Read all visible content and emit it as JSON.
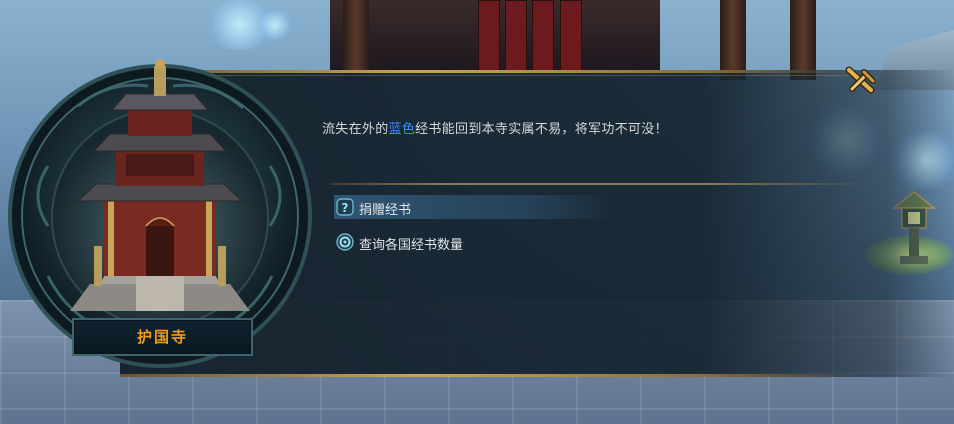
{
  "npc": {
    "name": "护国寺"
  },
  "dialog": {
    "message_before": "流失在外的",
    "message_highlight": "蓝色",
    "message_after": "经书能回到本寺实属不易，将军功不可没！",
    "highlight_color": "#3d8cff",
    "options": [
      {
        "label": "捐赠经书",
        "icon": "question-icon",
        "selected": true
      },
      {
        "label": "查询各国经书数量",
        "icon": "ring-icon",
        "selected": false
      }
    ]
  },
  "colors": {
    "name_text": "#f29a1e",
    "frame_teal": "#3f6570",
    "frame_gold": "#c9a55a"
  },
  "icons": {
    "close": "close-icon"
  }
}
